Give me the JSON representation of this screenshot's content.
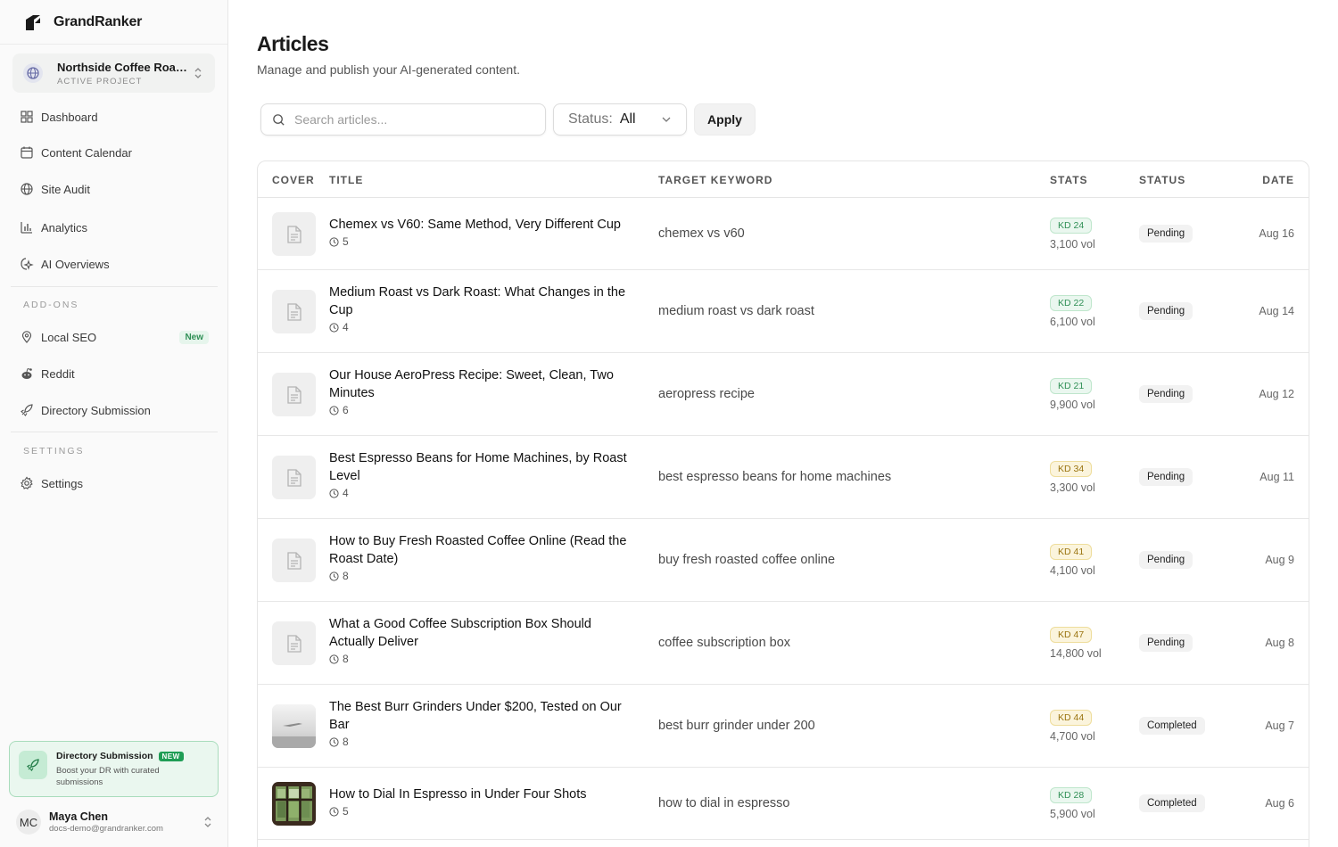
{
  "brand": {
    "name": "GrandRanker"
  },
  "project": {
    "name": "Northside Coffee Roasters",
    "label": "ACTIVE PROJECT"
  },
  "nav": {
    "dashboard": "Dashboard",
    "content_calendar": "Content Calendar",
    "site_audit": "Site Audit",
    "analytics": "Analytics",
    "ai_overviews": "AI Overviews",
    "addons_label": "ADD-ONS",
    "local_seo": "Local SEO",
    "local_seo_badge": "New",
    "reddit": "Reddit",
    "directory_submission": "Directory Submission",
    "settings_label": "SETTINGS",
    "settings": "Settings"
  },
  "promo": {
    "title": "Directory Submission",
    "badge": "NEW",
    "desc": "Boost your DR with curated submissions"
  },
  "user": {
    "initials": "MC",
    "name": "Maya Chen",
    "email": "docs-demo@grandranker.com"
  },
  "page": {
    "title": "Articles",
    "subtitle": "Manage and publish your AI-generated content."
  },
  "filters": {
    "search_placeholder": "Search articles...",
    "status_label": "Status:",
    "status_value": "All",
    "apply_label": "Apply"
  },
  "table": {
    "headers": {
      "cover": "COVER",
      "title": "TITLE",
      "keyword": "TARGET KEYWORD",
      "stats": "STATS",
      "status": "STATUS",
      "date": "DATE"
    },
    "rows": [
      {
        "title": "Chemex vs V60: Same Method, Very Different Cup",
        "read": "5",
        "keyword": "chemex vs v60",
        "kd": "KD 24",
        "kd_color": "green",
        "vol": "3,100 vol",
        "status": "Pending",
        "date": "Aug 16",
        "cover": "doc-icon"
      },
      {
        "title": "Medium Roast vs Dark Roast: What Changes in the Cup",
        "read": "4",
        "keyword": "medium roast vs dark roast",
        "kd": "KD 22",
        "kd_color": "green",
        "vol": "6,100 vol",
        "status": "Pending",
        "date": "Aug 14",
        "cover": "doc-icon"
      },
      {
        "title": "Our House AeroPress Recipe: Sweet, Clean, Two Minutes",
        "read": "6",
        "keyword": "aeropress recipe",
        "kd": "KD 21",
        "kd_color": "green",
        "vol": "9,900 vol",
        "status": "Pending",
        "date": "Aug 12",
        "cover": "doc-icon"
      },
      {
        "title": "Best Espresso Beans for Home Machines, by Roast Level",
        "read": "4",
        "keyword": "best espresso beans for home machines",
        "kd": "KD 34",
        "kd_color": "amber",
        "vol": "3,300 vol",
        "status": "Pending",
        "date": "Aug 11",
        "cover": "doc-icon"
      },
      {
        "title": "How to Buy Fresh Roasted Coffee Online (Read the Roast Date)",
        "read": "8",
        "keyword": "buy fresh roasted coffee online",
        "kd": "KD 41",
        "kd_color": "amber",
        "vol": "4,100 vol",
        "status": "Pending",
        "date": "Aug 9",
        "cover": "doc-icon"
      },
      {
        "title": "What a Good Coffee Subscription Box Should Actually Deliver",
        "read": "8",
        "keyword": "coffee subscription box",
        "kd": "KD 47",
        "kd_color": "amber",
        "vol": "14,800 vol",
        "status": "Pending",
        "date": "Aug 8",
        "cover": "doc-icon"
      },
      {
        "title": "The Best Burr Grinders Under $200, Tested on Our Bar",
        "read": "8",
        "keyword": "best burr grinder under 200",
        "kd": "KD 44",
        "kd_color": "amber",
        "vol": "4,700 vol",
        "status": "Completed",
        "date": "Aug 7",
        "cover": "sky-photo"
      },
      {
        "title": "How to Dial In Espresso in Under Four Shots",
        "read": "5",
        "keyword": "how to dial in espresso",
        "kd": "KD 28",
        "kd_color": "green",
        "vol": "5,900 vol",
        "status": "Completed",
        "date": "Aug 6",
        "cover": "window-photo"
      }
    ]
  },
  "colors": {
    "accent_green": "#2f8f55",
    "amber": "#9a7410"
  }
}
